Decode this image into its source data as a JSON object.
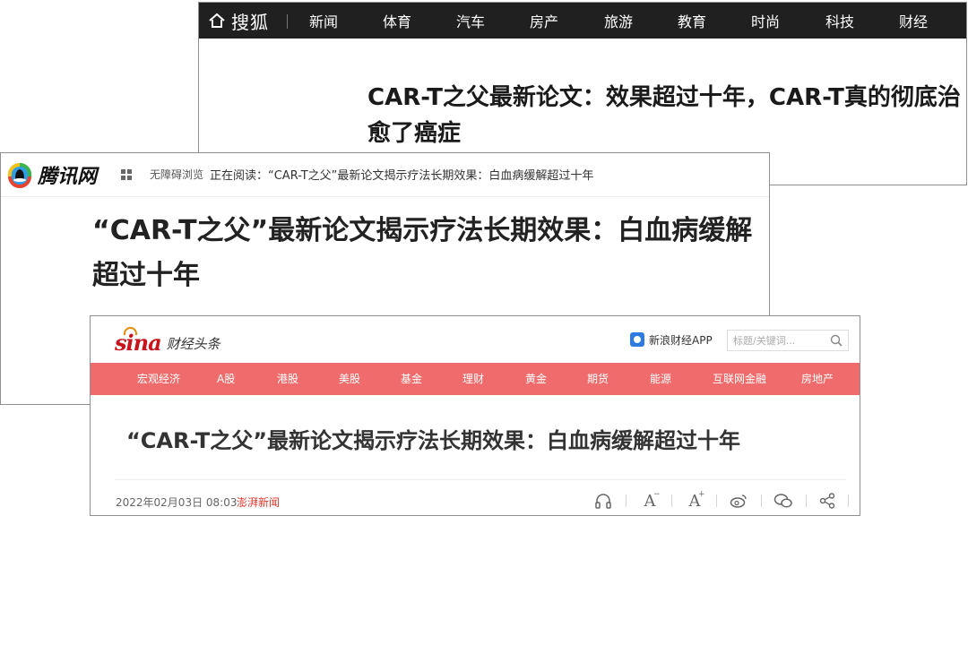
{
  "sohu": {
    "logo_text": "搜狐",
    "nav": [
      "新闻",
      "体育",
      "汽车",
      "房产",
      "旅游",
      "教育",
      "时尚",
      "科技",
      "财经"
    ],
    "title": "CAR-T之父最新论文：效果超过十年，CAR-T真的彻底治愈了癌症"
  },
  "tencent": {
    "logo_text": "腾讯网",
    "accessibility": "无障碍浏览",
    "reading": "正在阅读：“CAR-T之父”最新论文揭示疗法长期效果：白血病缓解超过十年",
    "title": "“CAR-T之父”最新论文揭示疗法长期效果：白血病缓解超过十年"
  },
  "sina": {
    "logo_word": "sina",
    "logo_sub": "财经头条",
    "app_label": "新浪财经APP",
    "search_placeholder": "标题/关键词...",
    "nav": [
      "宏观经济",
      "A股",
      "港股",
      "美股",
      "基金",
      "理财",
      "黄金",
      "期货",
      "能源",
      "互联网金融",
      "房地产"
    ],
    "title": "“CAR-T之父”最新论文揭示疗法长期效果：白血病缓解超过十年",
    "date": "2022年02月03日 08:03",
    "source": "澎湃新闻",
    "tools": [
      "headphones-icon",
      "font-decrease-icon",
      "font-increase-icon",
      "weibo-icon",
      "wechat-icon",
      "share-icon"
    ]
  }
}
